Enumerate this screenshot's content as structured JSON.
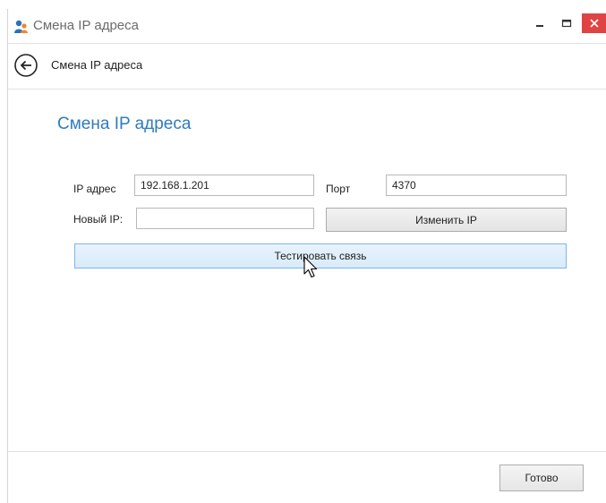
{
  "window": {
    "title": "Смена IP адреса",
    "controls": {
      "minimize": "–",
      "maximize": "□",
      "close": "✕"
    }
  },
  "navbar": {
    "title": "Смена IP адреса"
  },
  "main": {
    "heading": "Смена IP адреса",
    "ip_label": "IP адрес",
    "ip_value": "192.168.1.201",
    "port_label": "Порт",
    "port_value": "4370",
    "new_ip_label": "Новый IP:",
    "new_ip_value": "",
    "change_ip_button": "Изменить IP",
    "test_button": "Тестировать связь"
  },
  "footer": {
    "done_button": "Готово"
  },
  "colors": {
    "heading": "#2f7bbd",
    "close_button": "#e04343",
    "primary_button_fill": "#d8ebfb",
    "primary_button_border": "#7eb4ea"
  },
  "icons": [
    "app-users-icon",
    "back-arrow-icon",
    "mouse-cursor-icon"
  ]
}
